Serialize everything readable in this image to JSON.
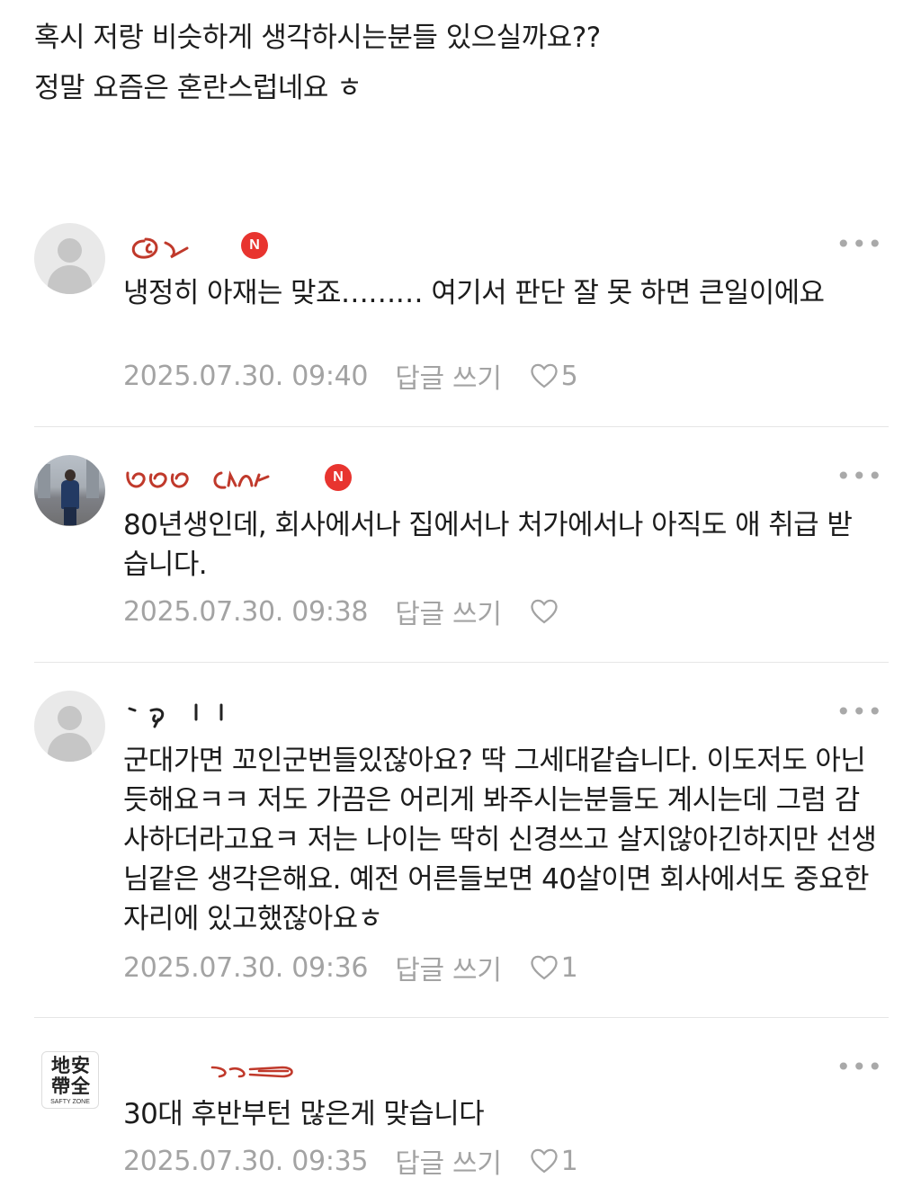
{
  "post": {
    "line1": "혹시 저랑 비슷하게 생각하시는분들 있으실까요??",
    "line2": "정말 요즘은 혼란스럽네요 ㅎ"
  },
  "comments": [
    {
      "avatar": "default-avatar",
      "badge": "N",
      "more_icon": "more-icon",
      "text": "냉정히 아재는 맞죠……… 여기서 판단 잘 못 하면 큰일이에요",
      "date": "2025.07.30. 09:40",
      "reply_label": "답글 쓰기",
      "likes": "5"
    },
    {
      "avatar": "photo-avatar",
      "badge": "N",
      "more_icon": "more-icon",
      "text": "80년생인데, 회사에서나 집에서나 처가에서나 아직도 애 취급 받습니다.",
      "date": "2025.07.30. 09:38",
      "reply_label": "답글 쓰기",
      "likes": ""
    },
    {
      "avatar": "default-avatar",
      "more_icon": "more-icon",
      "text": "군대가면 꼬인군번들있잖아요? 딱 그세대같습니다. 이도저도 아닌듯해요ㅋㅋ 저도 가끔은 어리게 봐주시는분들도 계시는데 그럼 감사하더라고요ㅋ 저는 나이는 딱히 신경쓰고 살지않아긴하지만 선생님같은 생각은해요. 예전 어른들보면 40살이면 회사에서도 중요한자리에 있고했잖아요ㅎ",
      "date": "2025.07.30. 09:36",
      "reply_label": "답글 쓰기",
      "likes": "1"
    },
    {
      "avatar": "safety-zone-logo",
      "avatar_chars": "地安帶全",
      "avatar_sub": "SAFTY ZONE",
      "more_icon": "more-icon",
      "text": "30대 후반부턴 많은게 맞습니다",
      "date": "2025.07.30. 09:35",
      "reply_label": "답글 쓰기",
      "likes": "1"
    }
  ],
  "colors": {
    "badge": "#e8342f",
    "meta_text": "#a3a3a3",
    "divider": "#e6e6e6",
    "scribble": "#c0392b"
  }
}
